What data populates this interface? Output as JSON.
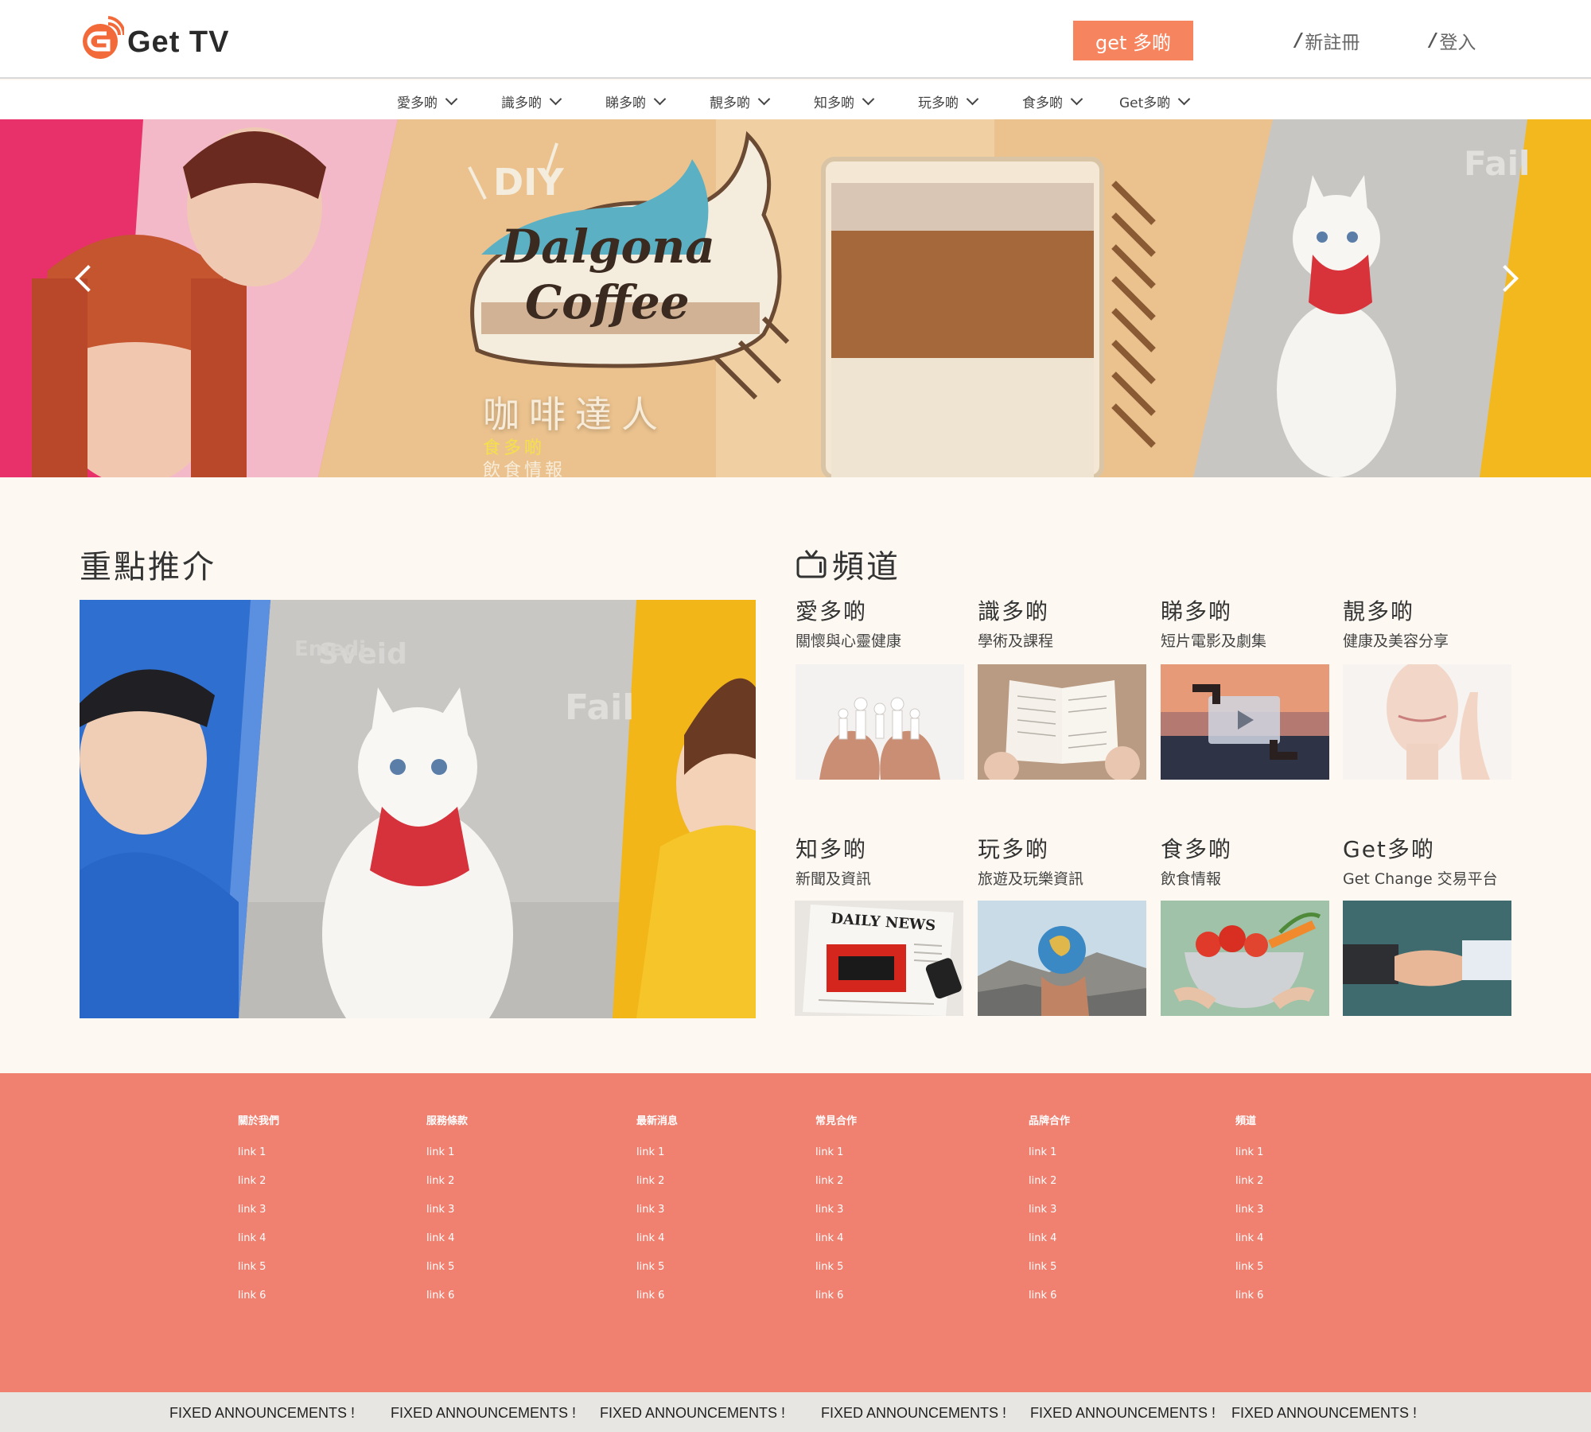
{
  "brand": {
    "name": "Get TV"
  },
  "header": {
    "get_button": "get 多啲",
    "register": "新註冊",
    "login": "登入"
  },
  "nav": [
    "愛多啲",
    "識多啲",
    "睇多啲",
    "靚多啲",
    "知多啲",
    "玩多啲",
    "食多啲",
    "Get多啲"
  ],
  "hero": {
    "badge": "DIY",
    "logo_line1": "Dalgona",
    "logo_line2": "Coffee",
    "title": "咖啡達人",
    "category": "食多啲",
    "subtitle": "飲食情報",
    "bg_text": "Fail"
  },
  "featured": {
    "title": "重點推介",
    "bg_words": [
      "Emedi",
      "Sveid",
      "Fail"
    ]
  },
  "channels": {
    "title": "頻道",
    "items": [
      {
        "name": "愛多啲",
        "desc": "關懷與心靈健康"
      },
      {
        "name": "識多啲",
        "desc": "學術及課程"
      },
      {
        "name": "睇多啲",
        "desc": "短片電影及劇集"
      },
      {
        "name": "靚多啲",
        "desc": "健康及美容分享"
      },
      {
        "name": "知多啲",
        "desc": "新聞及資訊"
      },
      {
        "name": "玩多啲",
        "desc": "旅遊及玩樂資訊"
      },
      {
        "name": "食多啲",
        "desc": "飲食情報"
      },
      {
        "name": "Get多啲",
        "desc": "Get Change 交易平台"
      }
    ],
    "newspaper_text": "DAILY NEWS"
  },
  "footer": {
    "columns": [
      {
        "title": "關於我們",
        "links": [
          "link 1",
          "link 2",
          "link 3",
          "link 4",
          "link 5",
          "link 6"
        ]
      },
      {
        "title": "服務條款",
        "links": [
          "link 1",
          "link 2",
          "link 3",
          "link 4",
          "link 5",
          "link 6"
        ]
      },
      {
        "title": "最新消息",
        "links": [
          "link 1",
          "link 2",
          "link 3",
          "link 4",
          "link 5",
          "link 6"
        ]
      },
      {
        "title": "常見合作",
        "links": [
          "link 1",
          "link 2",
          "link 3",
          "link 4",
          "link 5",
          "link 6"
        ]
      },
      {
        "title": "品牌合作",
        "links": [
          "link 1",
          "link 2",
          "link 3",
          "link 4",
          "link 5",
          "link 6"
        ]
      },
      {
        "title": "頻道",
        "links": [
          "link 1",
          "link 2",
          "link 3",
          "link 4",
          "link 5",
          "link 6"
        ]
      }
    ]
  },
  "announcements": [
    "FIXED ANNOUNCEMENTS !",
    "FIXED ANNOUNCEMENTS !",
    "FIXED ANNOUNCEMENTS !",
    "FIXED ANNOUNCEMENTS !",
    "FIXED ANNOUNCEMENTS !",
    "FIXED ANNOUNCEMENTS !"
  ],
  "colors": {
    "accent": "#f6855f",
    "footer": "#f08070",
    "background": "#fdf9f2"
  }
}
